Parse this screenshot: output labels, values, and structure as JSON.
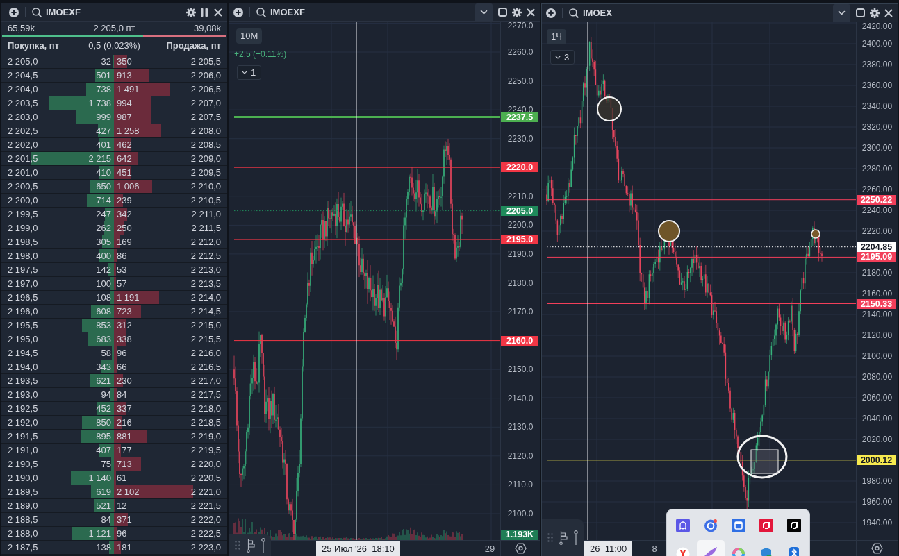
{
  "order_book": {
    "symbol": "IMOEXF",
    "stats": {
      "buy_volume": "65,59k",
      "last_price": "2 205,0 пт",
      "sell_volume": "39,08k",
      "balance": {
        "level": 0.63
      }
    },
    "columns": {
      "buy": "Покупка, пт",
      "spread": "0,5 (0,023%)",
      "sell": "Продажа, пт"
    },
    "rows": [
      {
        "bid_price": "2 205,0",
        "bid": {
          "qty": "32",
          "level": 0.011
        },
        "ask": {
          "qty": "350",
          "level": 0.117
        },
        "ask_price": "2 205,5"
      },
      {
        "bid_price": "2 204,5",
        "bid": {
          "qty": "501",
          "level": 0.167
        },
        "ask": {
          "qty": "913",
          "level": 0.304
        },
        "ask_price": "2 206,0"
      },
      {
        "bid_price": "2 204,0",
        "bid": {
          "qty": "738",
          "level": 0.246
        },
        "ask": {
          "qty": "1 491",
          "level": 0.497
        },
        "ask_price": "2 206,5"
      },
      {
        "bid_price": "2 203,5",
        "bid": {
          "qty": "1 738",
          "level": 0.579
        },
        "ask": {
          "qty": "994",
          "level": 0.331
        },
        "ask_price": "2 207,0"
      },
      {
        "bid_price": "2 203,0",
        "bid": {
          "qty": "999",
          "level": 0.333
        },
        "ask": {
          "qty": "987",
          "level": 0.329
        },
        "ask_price": "2 207,5"
      },
      {
        "bid_price": "2 202,5",
        "bid": {
          "qty": "427",
          "level": 0.142
        },
        "ask": {
          "qty": "1 258",
          "level": 0.419
        },
        "ask_price": "2 208,0"
      },
      {
        "bid_price": "2 202,0",
        "bid": {
          "qty": "401",
          "level": 0.134
        },
        "ask": {
          "qty": "462",
          "level": 0.154
        },
        "ask_price": "2 208,5"
      },
      {
        "bid_price": "2 201,5",
        "bid": {
          "qty": "2 215",
          "level": 0.738
        },
        "ask": {
          "qty": "642",
          "level": 0.214
        },
        "ask_price": "2 209,0"
      },
      {
        "bid_price": "2 201,0",
        "bid": {
          "qty": "410",
          "level": 0.137
        },
        "ask": {
          "qty": "451",
          "level": 0.15
        },
        "ask_price": "2 209,5"
      },
      {
        "bid_price": "2 200,5",
        "bid": {
          "qty": "650",
          "level": 0.217
        },
        "ask": {
          "qty": "1 006",
          "level": 0.335
        },
        "ask_price": "2 210,0"
      },
      {
        "bid_price": "2 200,0",
        "bid": {
          "qty": "714",
          "level": 0.238
        },
        "ask": {
          "qty": "239",
          "level": 0.08
        },
        "ask_price": "2 210,5"
      },
      {
        "bid_price": "2 199,5",
        "bid": {
          "qty": "247",
          "level": 0.082
        },
        "ask": {
          "qty": "342",
          "level": 0.114
        },
        "ask_price": "2 211,0"
      },
      {
        "bid_price": "2 199,0",
        "bid": {
          "qty": "262",
          "level": 0.087
        },
        "ask": {
          "qty": "250",
          "level": 0.083
        },
        "ask_price": "2 211,5"
      },
      {
        "bid_price": "2 198,5",
        "bid": {
          "qty": "305",
          "level": 0.102
        },
        "ask": {
          "qty": "169",
          "level": 0.056
        },
        "ask_price": "2 212,0"
      },
      {
        "bid_price": "2 198,0",
        "bid": {
          "qty": "400",
          "level": 0.133
        },
        "ask": {
          "qty": "86",
          "level": 0.029
        },
        "ask_price": "2 212,5"
      },
      {
        "bid_price": "2 197,5",
        "bid": {
          "qty": "142",
          "level": 0.047
        },
        "ask": {
          "qty": "53",
          "level": 0.018
        },
        "ask_price": "2 213,0"
      },
      {
        "bid_price": "2 197,0",
        "bid": {
          "qty": "100",
          "level": 0.033
        },
        "ask": {
          "qty": "57",
          "level": 0.019
        },
        "ask_price": "2 213,5"
      },
      {
        "bid_price": "2 196,5",
        "bid": {
          "qty": "108",
          "level": 0.036
        },
        "ask": {
          "qty": "1 191",
          "level": 0.397
        },
        "ask_price": "2 214,0"
      },
      {
        "bid_price": "2 196,0",
        "bid": {
          "qty": "608",
          "level": 0.203
        },
        "ask": {
          "qty": "723",
          "level": 0.241
        },
        "ask_price": "2 214,5"
      },
      {
        "bid_price": "2 195,5",
        "bid": {
          "qty": "853",
          "level": 0.284
        },
        "ask": {
          "qty": "312",
          "level": 0.104
        },
        "ask_price": "2 215,0"
      },
      {
        "bid_price": "2 195,0",
        "bid": {
          "qty": "683",
          "level": 0.228
        },
        "ask": {
          "qty": "338",
          "level": 0.113
        },
        "ask_price": "2 215,5"
      },
      {
        "bid_price": "2 194,5",
        "bid": {
          "qty": "58",
          "level": 0.019
        },
        "ask": {
          "qty": "96",
          "level": 0.032
        },
        "ask_price": "2 216,0"
      },
      {
        "bid_price": "2 194,0",
        "bid": {
          "qty": "343",
          "level": 0.114
        },
        "ask": {
          "qty": "66",
          "level": 0.022
        },
        "ask_price": "2 216,5"
      },
      {
        "bid_price": "2 193,5",
        "bid": {
          "qty": "621",
          "level": 0.207
        },
        "ask": {
          "qty": "230",
          "level": 0.077
        },
        "ask_price": "2 217,0"
      },
      {
        "bid_price": "2 193,0",
        "bid": {
          "qty": "94",
          "level": 0.031
        },
        "ask": {
          "qty": "84",
          "level": 0.028
        },
        "ask_price": "2 217,5"
      },
      {
        "bid_price": "2 192,5",
        "bid": {
          "qty": "452",
          "level": 0.151
        },
        "ask": {
          "qty": "337",
          "level": 0.112
        },
        "ask_price": "2 218,0"
      },
      {
        "bid_price": "2 192,0",
        "bid": {
          "qty": "850",
          "level": 0.283
        },
        "ask": {
          "qty": "216",
          "level": 0.072
        },
        "ask_price": "2 218,5"
      },
      {
        "bid_price": "2 191,5",
        "bid": {
          "qty": "895",
          "level": 0.298
        },
        "ask": {
          "qty": "881",
          "level": 0.294
        },
        "ask_price": "2 219,0"
      },
      {
        "bid_price": "2 191,0",
        "bid": {
          "qty": "407",
          "level": 0.136
        },
        "ask": {
          "qty": "177",
          "level": 0.059
        },
        "ask_price": "2 219,5"
      },
      {
        "bid_price": "2 190,5",
        "bid": {
          "qty": "75",
          "level": 0.025
        },
        "ask": {
          "qty": "713",
          "level": 0.238
        },
        "ask_price": "2 220,0"
      },
      {
        "bid_price": "2 190,0",
        "bid": {
          "qty": "1 140",
          "level": 0.38
        },
        "ask": {
          "qty": "61",
          "level": 0.02
        },
        "ask_price": "2 220,5"
      },
      {
        "bid_price": "2 189,5",
        "bid": {
          "qty": "619",
          "level": 0.206
        },
        "ask": {
          "qty": "2 102",
          "level": 0.701
        },
        "ask_price": "2 221,0"
      },
      {
        "bid_price": "2 189,0",
        "bid": {
          "qty": "521",
          "level": 0.174
        },
        "ask": {
          "qty": "12",
          "level": 0.004
        },
        "ask_price": "2 221,5"
      },
      {
        "bid_price": "2 188,5",
        "bid": {
          "qty": "84",
          "level": 0.028
        },
        "ask": {
          "qty": "371",
          "level": 0.124
        },
        "ask_price": "2 222,0"
      },
      {
        "bid_price": "2 188,0",
        "bid": {
          "qty": "1 121",
          "level": 0.374
        },
        "ask": {
          "qty": "96",
          "level": 0.032
        },
        "ask_price": "2 222,5"
      },
      {
        "bid_price": "2 187,5",
        "bid": {
          "qty": "138",
          "level": 0.046
        },
        "ask": {
          "qty": "181",
          "level": 0.06
        },
        "ask_price": "2 223,0"
      }
    ]
  },
  "charts": [
    {
      "symbol": "IMOEXF",
      "timeframe": "10M",
      "change": "+2.5 (+0.11%)",
      "indicator_count": "1",
      "price_ticks": [
        "2270.0",
        "2260.0",
        "2250.0",
        "2240.0",
        "2230.0",
        "2210.0",
        "2200.0",
        "2190.0",
        "2180.0",
        "2170.0",
        "2150.0",
        "2140.0",
        "2130.0",
        "2120.0",
        "2110.0",
        "2100.0"
      ],
      "price_levels": [
        {
          "label": "2237.5",
          "kind": "thick_line",
          "color": "#4caf50"
        },
        {
          "label": "2220.0",
          "kind": "line",
          "color": "#f23645"
        },
        {
          "label": "2205.0",
          "kind": "last_price",
          "color": "#1f8a5b"
        },
        {
          "label": "2195.0",
          "kind": "line",
          "color": "#f23645"
        },
        {
          "label": "2160.0",
          "kind": "line",
          "color": "#f23645"
        }
      ],
      "volume_label": "1.193K",
      "crosshair_time": "25 Июл '26  18:10",
      "time_ticks": [
        "29"
      ]
    },
    {
      "symbol": "IMOEX",
      "timeframe": "1Ч",
      "indicator_count": "3",
      "price_ticks": [
        "2420.00",
        "2400.00",
        "2380.00",
        "2360.00",
        "2340.00",
        "2320.00",
        "2300.00",
        "2280.00",
        "2260.00",
        "2240.00",
        "2220.00",
        "2180.00",
        "2160.00",
        "2140.00",
        "2120.00",
        "2100.00",
        "2080.00",
        "2060.00",
        "2040.00",
        "2020.00",
        "1980.00",
        "1960.00",
        "1940.00"
      ],
      "price_levels": [
        {
          "label": "2250.22",
          "kind": "line",
          "color": "#f23f5a"
        },
        {
          "label": "2204.85",
          "kind": "last_price",
          "color": "#ffffff"
        },
        {
          "label": "2195.09",
          "kind": "line",
          "color": "#f23f5a"
        },
        {
          "label": "2150.33",
          "kind": "line",
          "color": "#f23f5a"
        },
        {
          "label": "2000.12",
          "kind": "line",
          "color": "#f7ea4f"
        }
      ],
      "crosshair_time": "26  11:00",
      "time_ticks": [
        "8"
      ]
    }
  ],
  "tray_flyout": {
    "items": [
      {
        "kind": "ghost",
        "selected": false
      },
      {
        "kind": "ring",
        "selected": false
      },
      {
        "kind": "window",
        "selected": false
      },
      {
        "kind": "arrow",
        "selected": false
      },
      {
        "kind": "arrow_dark",
        "selected": false
      },
      {
        "kind": "browser",
        "selected": false
      },
      {
        "kind": "feather",
        "selected": true
      },
      {
        "kind": "colorful",
        "selected": false
      },
      {
        "kind": "shield",
        "selected": false
      },
      {
        "kind": "bluetooth",
        "selected": false
      }
    ]
  }
}
